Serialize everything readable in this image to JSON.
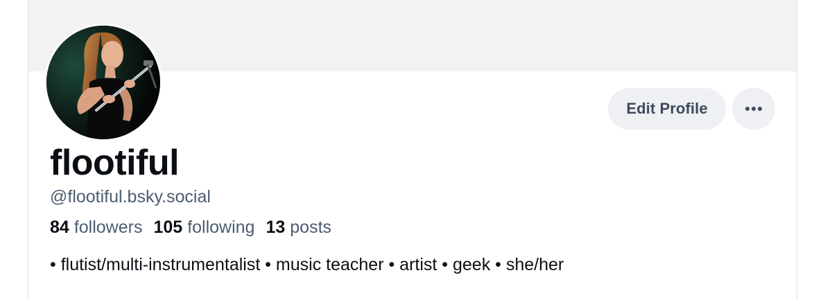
{
  "profile": {
    "display_name": "flootiful",
    "handle": "@flootiful.bsky.social",
    "bio": "• flutist/multi-instrumentalist • music teacher • artist • geek • she/her",
    "stats": {
      "followers_count": "84",
      "followers_label": "followers",
      "following_count": "105",
      "following_label": "following",
      "posts_count": "13",
      "posts_label": "posts"
    }
  },
  "actions": {
    "edit_profile_label": "Edit Profile",
    "more_icon": "ellipsis-icon"
  },
  "colors": {
    "banner": "#f1f2f3",
    "button_bg": "#eef0f3",
    "button_text": "#3e4b5d",
    "secondary_text": "#4c5c70",
    "primary_text": "#0b0f14"
  }
}
